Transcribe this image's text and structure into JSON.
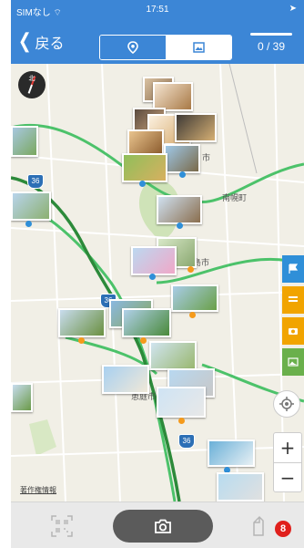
{
  "status_bar": {
    "carrier": "SIMなし",
    "time": "17:51",
    "location_arrow": "➤"
  },
  "header": {
    "back_label": "戻る",
    "tabs": [
      {
        "icon": "map-pin-icon",
        "active": true
      },
      {
        "icon": "photo-icon",
        "active": false
      }
    ],
    "counter": "0 / 39"
  },
  "map": {
    "towns": [
      "市",
      "南幌町",
      "島市",
      "恵庭市"
    ],
    "route_numbers": [
      "36",
      "36",
      "36"
    ],
    "copyright": "著作権情報",
    "compass_label": "北",
    "side_tabs": [
      {
        "icon": "flag-icon",
        "color": "#2f8fd8"
      },
      {
        "icon": "list-icon",
        "color": "#f1a400"
      },
      {
        "icon": "camera-icon",
        "color": "#f1a400"
      },
      {
        "icon": "image-icon",
        "color": "#6ab04c"
      }
    ],
    "zoom_in": "+",
    "zoom_out": "−"
  },
  "toolbar": {
    "badge_count": "8"
  },
  "colors": {
    "primary": "#3c86d6",
    "road": "#4cc26a",
    "highway": "#58b94c",
    "dot_blue": "#2f8fd8",
    "dot_orange": "#f59a1b"
  }
}
